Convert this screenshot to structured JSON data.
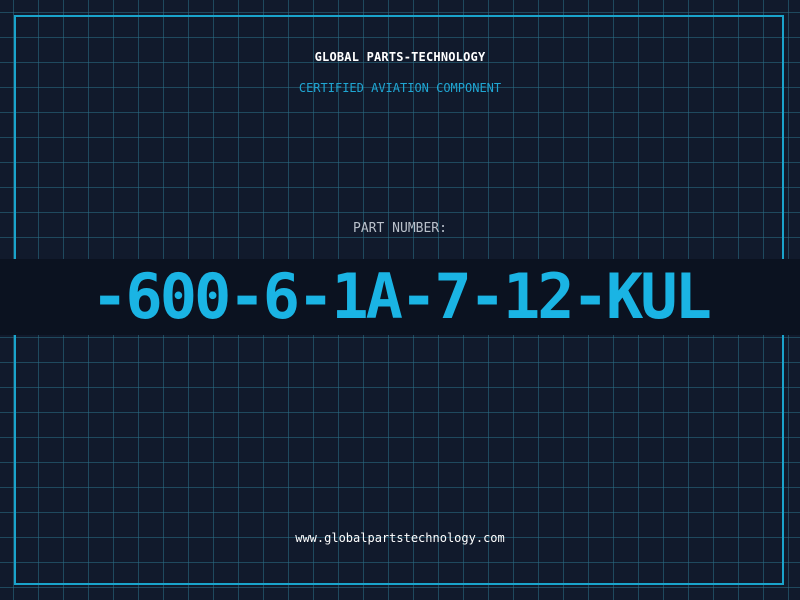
{
  "header": {
    "company": "GLOBAL PARTS-TECHNOLOGY",
    "subtitle": "CERTIFIED AVIATION COMPONENT"
  },
  "part": {
    "label": "PART NUMBER:",
    "value": "-600-6-1A-7-12-KUL"
  },
  "footer": {
    "website": "www.globalpartstechnology.com"
  },
  "colors": {
    "background": "#111a2c",
    "grid": "#2a6f87",
    "frame": "#1aa4cc",
    "accent": "#1ab4e4",
    "band": "#0b1220"
  }
}
